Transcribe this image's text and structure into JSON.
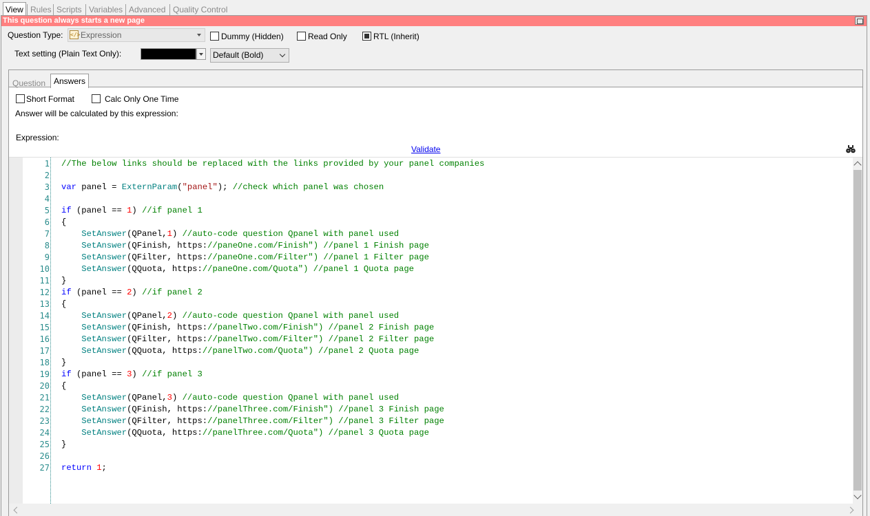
{
  "top_tabs": [
    "View",
    "Rules",
    "Scripts",
    "Variables",
    "Advanced",
    "Quality Control"
  ],
  "banner": "This question always starts a new page",
  "question_type": {
    "label": "Question Type:",
    "value": "Expression",
    "icon": "expression-icon"
  },
  "checkboxes": {
    "dummy": {
      "label": "Dummy (Hidden)",
      "checked": false
    },
    "readonly": {
      "label": "Read Only",
      "checked": false
    },
    "rtl": {
      "label": "RTL (Inherit)",
      "checked": true
    }
  },
  "text_setting": {
    "label": "Text setting (Plain Text Only):",
    "color": "#000000",
    "font": "Default (Bold)"
  },
  "inner_tabs": [
    "Question",
    "Answers"
  ],
  "answers": {
    "short_format": "Short Format",
    "calc_once": "Calc Only One Time",
    "note": "Answer will be calculated by this expression:",
    "expression_label": "Expression:",
    "validate": "Validate"
  },
  "code_lines": [
    "//The below links should be replaced with the links provided by your panel companies",
    "",
    "var panel = ExternParam(\"panel\"); //check which panel was chosen",
    "",
    "if (panel == 1) //if panel 1",
    "{",
    "    SetAnswer(QPanel,1) //auto-code question Qpanel with panel used",
    "    SetAnswer(QFinish, \"https://paneOne.com/Finish\") //panel 1 Finish page",
    "    SetAnswer(QFilter, \"https://paneOne.com/Filter\") //panel 1 Filter page",
    "    SetAnswer(QQuota, \"https://paneOne.com/Quota\") //panel 1 Quota page",
    "}",
    "if (panel == 2) //if panel 2",
    "{",
    "    SetAnswer(QPanel,2) //auto-code question Qpanel with panel used",
    "    SetAnswer(QFinish, \"https://panelTwo.com/Finish\") //panel 2 Finish page",
    "    SetAnswer(QFilter, \"https://panelTwo.com/Filter\") //panel 2 Filter page",
    "    SetAnswer(QQuota, \"https://panelTwo.com/Quota\") //panel 2 Quota page",
    "}",
    "if (panel == 3) //if panel 3",
    "{",
    "    SetAnswer(QPanel,3) //auto-code question Qpanel with panel used",
    "    SetAnswer(QFinish, \"https://panelThree.com/Finish\") //panel 3 Finish page",
    "    SetAnswer(QFilter, \"https://panelThree.com/Filter\") //panel 3 Filter page",
    "    SetAnswer(QQuota, \"https://panelThree.com/Quota\") //panel 3 Quota page",
    "}",
    "",
    "return 1;"
  ],
  "code_line_numbers": [
    "1",
    "2",
    "3",
    "4",
    "5",
    "6",
    "7",
    "8",
    "9",
    "10",
    "11",
    "12",
    "13",
    "14",
    "15",
    "16",
    "17",
    "18",
    "19",
    "20",
    "21",
    "22",
    "23",
    "24",
    "25",
    "26",
    "27"
  ],
  "colors": {
    "banner": "#ff8080",
    "comment": "#008000",
    "keyword": "#0000ff",
    "function": "#008080",
    "string": "#a31515",
    "number": "#ff0000",
    "line_number": "#2a8c8c"
  }
}
